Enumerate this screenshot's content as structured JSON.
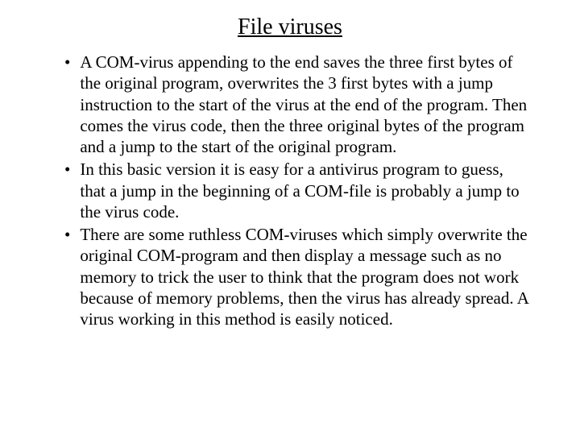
{
  "title": "File viruses",
  "bullets": [
    {
      "text": "A COM-virus appending to the end saves the three first bytes of the original program, overwrites the 3 first bytes with a jump instruction to the start of the virus at the end of the program. Then comes the virus code, then the three original bytes of the program and a jump to the start of the original program."
    },
    {
      "text": "In this basic version it is easy for a antivirus program to guess, that a jump in the beginning of a COM-file is probably a jump to the virus code."
    },
    {
      "text": "There are some ruthless COM-viruses which simply overwrite the original COM-program and then display a message such as no memory to trick the user to think that the program does not work because of memory problems, then the virus has already spread. A virus working in this method is easily noticed."
    }
  ]
}
